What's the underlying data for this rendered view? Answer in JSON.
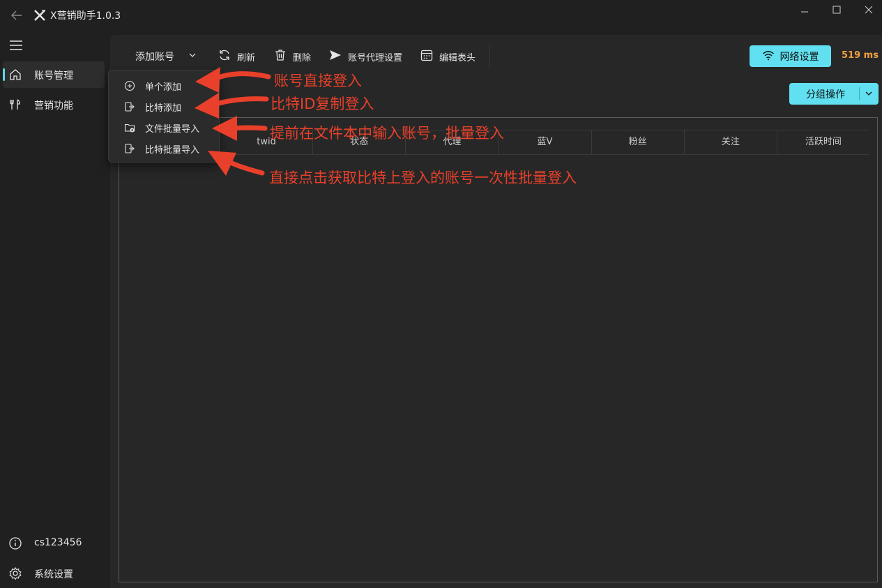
{
  "app": {
    "title": "X营销助手1.0.3"
  },
  "sidebar": {
    "items": [
      {
        "label": "账号管理",
        "icon": "home-icon",
        "active": true
      },
      {
        "label": "营销功能",
        "icon": "tools-icon",
        "active": false
      }
    ],
    "bottom": [
      {
        "label": "cs123456",
        "icon": "info-icon"
      },
      {
        "label": "系统设置",
        "icon": "gear-icon"
      }
    ]
  },
  "toolbar": {
    "add_account": "添加账号",
    "refresh": "刷新",
    "delete": "删除",
    "proxy_settings": "账号代理设置",
    "edit_header": "编辑表头",
    "network_settings": "网络设置",
    "latency": "519 ms",
    "group_ops": "分组操作"
  },
  "table": {
    "columns": [
      "twid",
      "状态",
      "代理",
      "蓝V",
      "粉丝",
      "关注",
      "活跃时间"
    ],
    "rows": []
  },
  "dropdown": {
    "items": [
      {
        "label": "单个添加",
        "icon": "plus-circle-icon"
      },
      {
        "label": "比特添加",
        "icon": "login-icon"
      },
      {
        "label": "文件批量导入",
        "icon": "folder-add-icon"
      },
      {
        "label": "比特批量导入",
        "icon": "login-icon"
      }
    ]
  },
  "annotations": [
    "账号直接登入",
    "比特ID复制登入",
    "提前在文件本中输入账号，批量登入",
    "直接点击获取比特上登入的账号一次性批量登入"
  ],
  "colors": {
    "accent": "#60e0f0",
    "annotation": "#e8402a",
    "latency": "#f0a040"
  }
}
